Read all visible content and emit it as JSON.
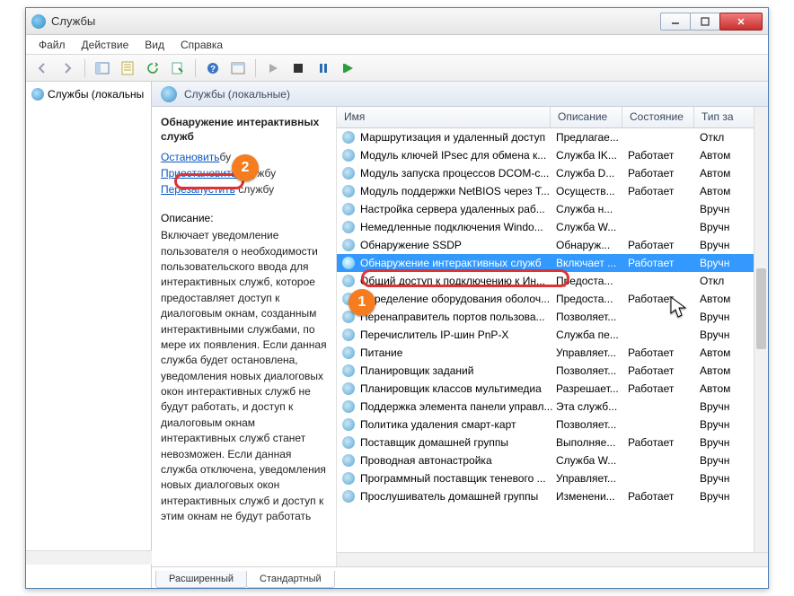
{
  "window": {
    "title": "Службы"
  },
  "menu": {
    "file": "Файл",
    "action": "Действие",
    "view": "Вид",
    "help": "Справка"
  },
  "tree": {
    "root": "Службы (локальны"
  },
  "header": {
    "title": "Службы (локальные)"
  },
  "details": {
    "title": "Обнаружение интерактивных служб",
    "stop_link": "Остановить",
    "stop_suffix": "бу",
    "pause_link": "Приостановить",
    "pause_suffix": " службу",
    "restart_link": "Перезапустить",
    "restart_suffix": " службу",
    "desc_label": "Описание:",
    "desc_text": "Включает уведомление пользователя о необходимости пользовательского ввода для интерактивных служб, которое предоставляет доступ к диалоговым окнам, созданным интерактивными службами, по мере их появления. Если данная служба будет остановлена, уведомления новых диалоговых окон интерактивных служб не будут работать, и доступ к диалоговым окнам интерактивных служб станет невозможен. Если данная служба отключена, уведомления новых диалоговых окон интерактивных служб и доступ к этим окнам не будут работать"
  },
  "columns": {
    "name": "Имя",
    "desc": "Описание",
    "state": "Состояние",
    "type": "Тип за"
  },
  "services": [
    {
      "name": "Маршрутизация и удаленный доступ",
      "desc": "Предлагае...",
      "state": "",
      "type": "Откл"
    },
    {
      "name": "Модуль ключей IPsec для обмена к...",
      "desc": "Служба IK...",
      "state": "Работает",
      "type": "Автом"
    },
    {
      "name": "Модуль запуска процессов DCOM-с...",
      "desc": "Служба D...",
      "state": "Работает",
      "type": "Автом"
    },
    {
      "name": "Модуль поддержки NetBIOS через T...",
      "desc": "Осуществ...",
      "state": "Работает",
      "type": "Автом"
    },
    {
      "name": "Настройка сервера удаленных раб...",
      "desc": "Служба н...",
      "state": "",
      "type": "Вручн"
    },
    {
      "name": "Немедленные подключения Windo...",
      "desc": "Служба W...",
      "state": "",
      "type": "Вручн"
    },
    {
      "name": "Обнаружение SSDP",
      "desc": "Обнаруж...",
      "state": "Работает",
      "type": "Вручн"
    },
    {
      "name": "Обнаружение интерактивных служб",
      "desc": "Включает ...",
      "state": "Работает",
      "type": "Вручн",
      "selected": true
    },
    {
      "name": "Общий доступ к подключению к Ин...",
      "desc": "Предоста...",
      "state": "",
      "type": "Откл"
    },
    {
      "name": "Определение оборудования оболоч...",
      "desc": "Предоста...",
      "state": "Работает",
      "type": "Автом"
    },
    {
      "name": "Перенаправитель портов пользова...",
      "desc": "Позволяет...",
      "state": "",
      "type": "Вручн"
    },
    {
      "name": "Перечислитель IP-шин PnP-X",
      "desc": "Служба пе...",
      "state": "",
      "type": "Вручн"
    },
    {
      "name": "Питание",
      "desc": "Управляет...",
      "state": "Работает",
      "type": "Автом"
    },
    {
      "name": "Планировщик заданий",
      "desc": "Позволяет...",
      "state": "Работает",
      "type": "Автом"
    },
    {
      "name": "Планировщик классов мультимедиа",
      "desc": "Разрешает...",
      "state": "Работает",
      "type": "Автом"
    },
    {
      "name": "Поддержка элемента панели управл...",
      "desc": "Эта служб...",
      "state": "",
      "type": "Вручн"
    },
    {
      "name": "Политика удаления смарт-карт",
      "desc": "Позволяет...",
      "state": "",
      "type": "Вручн"
    },
    {
      "name": "Поставщик домашней группы",
      "desc": "Выполняе...",
      "state": "Работает",
      "type": "Вручн"
    },
    {
      "name": "Проводная автонастройка",
      "desc": "Служба W...",
      "state": "",
      "type": "Вручн"
    },
    {
      "name": "Программный поставщик теневого ...",
      "desc": "Управляет...",
      "state": "",
      "type": "Вручн"
    },
    {
      "name": "Прослушиватель домашней группы",
      "desc": "Изменени...",
      "state": "Работает",
      "type": "Вручн"
    }
  ],
  "tabs": {
    "extended": "Расширенный",
    "standard": "Стандартный"
  },
  "annotations": {
    "badge1": "1",
    "badge2": "2"
  }
}
